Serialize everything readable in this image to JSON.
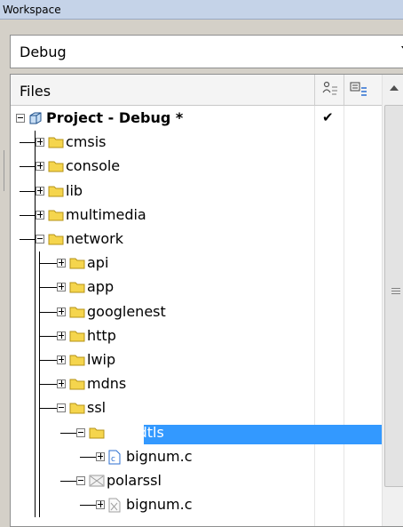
{
  "workspace": {
    "title": "Workspace"
  },
  "config_select": {
    "value": "Debug"
  },
  "files_panel": {
    "header_label": "Files",
    "project": {
      "label": "Project - Debug *",
      "checked": true
    },
    "items": [
      {
        "label": "cmsis"
      },
      {
        "label": "console"
      },
      {
        "label": "lib"
      },
      {
        "label": "multimedia"
      },
      {
        "label": "network"
      },
      {
        "label": "api"
      },
      {
        "label": "app"
      },
      {
        "label": "googlenest"
      },
      {
        "label": "http"
      },
      {
        "label": "lwip"
      },
      {
        "label": "mdns"
      },
      {
        "label": "ssl"
      },
      {
        "label": "mbedtls"
      },
      {
        "label": "bignum.c"
      },
      {
        "label": "polarssl"
      },
      {
        "label": "bignum.c"
      }
    ]
  },
  "colors": {
    "selection": "#3399ff",
    "folder": "#f5d54d"
  }
}
